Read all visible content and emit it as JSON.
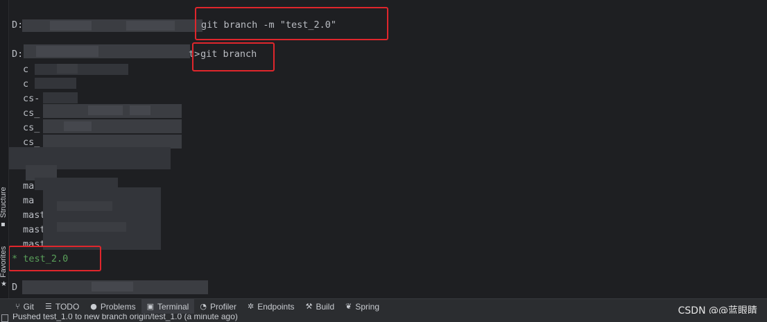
{
  "terminal": {
    "line1": {
      "prompt": "D:",
      "command": "git branch -m \"test_2.0\""
    },
    "line2": {
      "prompt": "D:\\",
      "tail": "t>",
      "command": "git branch"
    },
    "branches": [
      "c",
      "c",
      "cs-",
      "cs_",
      "cs_",
      "cs_",
      "ma",
      "ma",
      "mast",
      "mast",
      "mast"
    ],
    "current_branch": "* test_2.0",
    "last_prompt": "D"
  },
  "left_tabs": {
    "structure": "Structure",
    "favorites": "Favorites"
  },
  "toolbar": {
    "tabs": [
      {
        "label": "Git",
        "icon": "git-branch-icon"
      },
      {
        "label": "TODO",
        "icon": "list-icon"
      },
      {
        "label": "Problems",
        "icon": "info-icon"
      },
      {
        "label": "Terminal",
        "icon": "terminal-icon"
      },
      {
        "label": "Profiler",
        "icon": "profiler-icon"
      },
      {
        "label": "Endpoints",
        "icon": "endpoints-icon"
      },
      {
        "label": "Build",
        "icon": "hammer-icon"
      },
      {
        "label": "Spring",
        "icon": "spring-icon"
      }
    ],
    "active_tab": "Terminal"
  },
  "watermark": "CSDN @@蓝眼睛",
  "status": {
    "message": "Pushed test_1.0 to new branch origin/test_1.0 (a minute ago)"
  },
  "colors": {
    "background": "#1e1f22",
    "highlight_box": "#e0262c",
    "current_branch": "#5aa05a"
  }
}
